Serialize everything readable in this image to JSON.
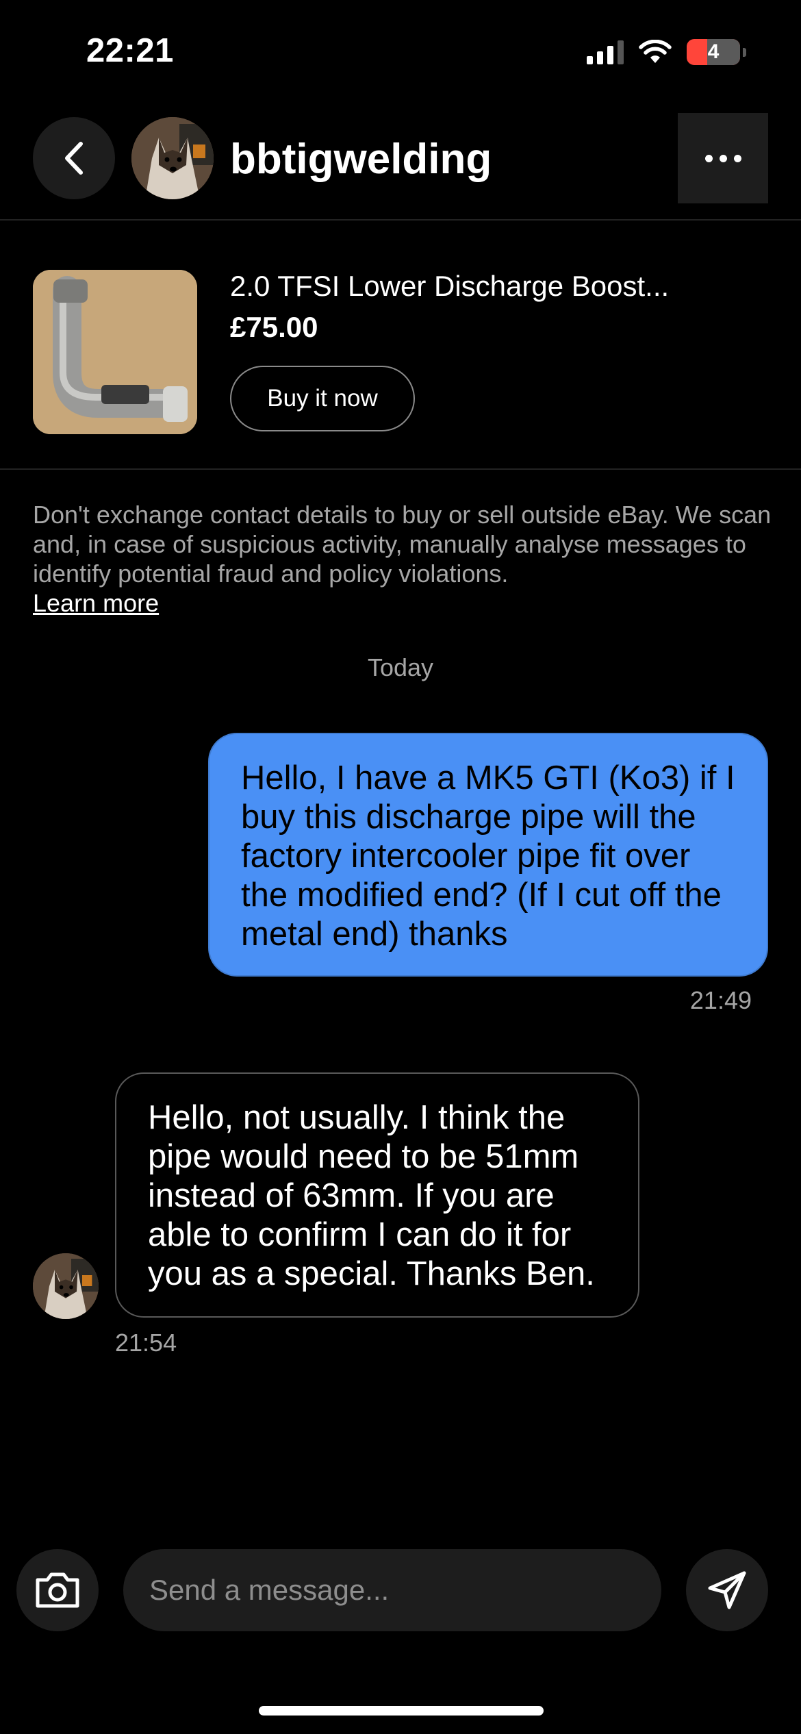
{
  "status_bar": {
    "time": "22:21",
    "battery": "4"
  },
  "header": {
    "username": "bbtigwelding",
    "back_icon": "chevron-left-icon",
    "more_icon": "ellipsis-icon"
  },
  "listing": {
    "title": "2.0 TFSI Lower Discharge Boost...",
    "price": "£75.00",
    "buy_label": "Buy it now"
  },
  "notice": {
    "text": "Don't exchange contact details to buy or sell outside eBay. We scan and, in case of suspicious activity, manually analyse messages to identify potential fraud and policy violations.",
    "link": "Learn more"
  },
  "conversation": {
    "day": "Today",
    "messages": [
      {
        "direction": "outgoing",
        "text": "Hello, I have a MK5 GTI (Ko3) if I buy this discharge pipe will the factory intercooler pipe fit over the modified end? (If I cut off the metal end) thanks",
        "time": "21:49"
      },
      {
        "direction": "incoming",
        "text": "Hello, not usually. I think the pipe would need to be 51mm instead of 63mm. If you are able to confirm I can do it for you as a special. Thanks Ben.",
        "time": "21:54"
      }
    ]
  },
  "composer": {
    "placeholder": "Send a message...",
    "camera_icon": "camera-icon",
    "send_icon": "send-icon"
  },
  "colors": {
    "background": "#000000",
    "outgoing_bubble": "#4a90f5",
    "surface": "#1d1d1d",
    "muted_text": "#a6a6a6"
  }
}
